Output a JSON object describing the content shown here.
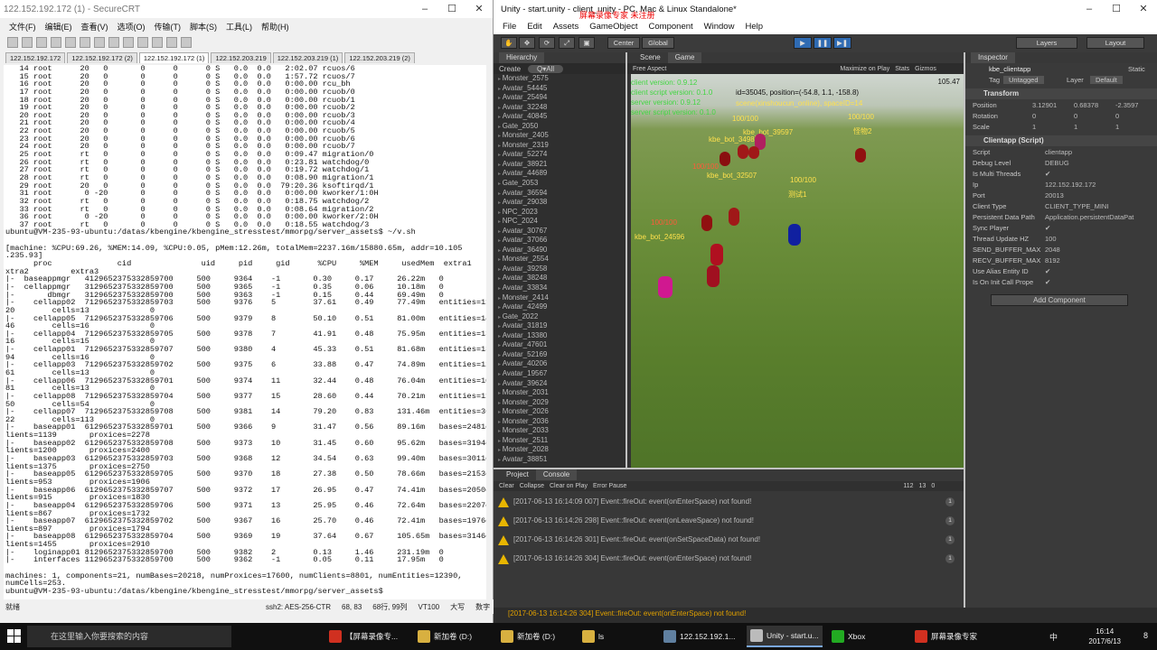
{
  "crt": {
    "title": "122.152.192.172 (1) - SecureCRT",
    "menu": [
      "文件(F)",
      "编辑(E)",
      "查看(V)",
      "选项(O)",
      "传输(T)",
      "脚本(S)",
      "工具(L)",
      "帮助(H)"
    ],
    "tabs": [
      "122.152.192.172",
      "122.152.192.172 (2)",
      "122.152.192.172 (1)",
      "122.152.203.219",
      "122.152.203.219 (1)",
      "122.152.203.219 (2)"
    ],
    "active_tab": 2,
    "terminal_lines": [
      "   14 root      20   0       0      0      0 S   0.0  0.0   2:02.07 rcuos/6",
      "   15 root      20   0       0      0      0 S   0.0  0.0   1:57.72 rcuos/7",
      "   16 root      20   0       0      0      0 S   0.0  0.0   0:00.00 rcu_bh",
      "   17 root      20   0       0      0      0 S   0.0  0.0   0:00.00 rcuob/0",
      "   18 root      20   0       0      0      0 S   0.0  0.0   0:00.00 rcuob/1",
      "   19 root      20   0       0      0      0 S   0.0  0.0   0:00.00 rcuob/2",
      "   20 root      20   0       0      0      0 S   0.0  0.0   0:00.00 rcuob/3",
      "   21 root      20   0       0      0      0 S   0.0  0.0   0:00.00 rcuob/4",
      "   22 root      20   0       0      0      0 S   0.0  0.0   0:00.00 rcuob/5",
      "   23 root      20   0       0      0      0 S   0.0  0.0   0:00.00 rcuob/6",
      "   24 root      20   0       0      0      0 S   0.0  0.0   0:00.00 rcuob/7",
      "   25 root      rt   0       0      0      0 S   0.0  0.0   0:09.47 migration/0",
      "   26 root      rt   0       0      0      0 S   0.0  0.0   0:23.81 watchdog/0",
      "   27 root      rt   0       0      0      0 S   0.0  0.0   0:19.72 watchdog/1",
      "   28 root      rt   0       0      0      0 S   0.0  0.0   0:08.90 migration/1",
      "   29 root      20   0       0      0      0 S   0.0  0.0  79:20.36 ksoftirqd/1",
      "   31 root       0 -20       0      0      0 S   0.0  0.0   0:00.00 kworker/1:0H",
      "   32 root      rt   0       0      0      0 S   0.0  0.0   0:18.75 watchdog/2",
      "   33 root      rt   0       0      0      0 S   0.0  0.0   0:08.64 migration/2",
      "   36 root       0 -20       0      0      0 S   0.0  0.0   0:00.00 kworker/2:0H",
      "   37 root      rt   0       0      0      0 S   0.0  0.0   0:18.55 watchdog/3",
      "ubuntu@VM-235-93-ubuntu:/datas/kbengine/kbengine_stresstest/mmorpg/server_assets$ ~/v.sh",
      "",
      "[machine: %CPU:69.26, %MEM:14.09, %CPU:0.05, pMem:12.26m, totalMem=2237.16m/15880.65m, addr=10.105",
      ".235.93]",
      "      proc              cid               uid     pid     gid      %CPU     %MEM     usedMem  extra1     e",
      "xtra2         extra3",
      "|-  baseappmgr   412965237533285970​0     500     9364    -1       0.30     0.17     26.22m   0          0",
      "|-  cellappmgr   312965237533285970​0     500     9365    -1       0.35     0.06     10.18m   0          0",
      "|-       dbmgr   312965237533285970​0     500     9363    -1       0.15     0.44     69.49m   0          0",
      "|-    cellapp02  712965237533285970​3     500     9376    5        37.61    0.49     77.49m   entities=11",
      "20        cells=13             0",
      "|-    cellapp05  712965237533285970​6     500     9379    8        50.10    0.51     81.00m   entities=14",
      "46        cells=16             0",
      "|-    cellapp04  712965237533285970​5     500     9378    7        41.91    0.48     75.95m   entities=13",
      "16        cells=15             0",
      "|-    cellapp01  712965237533285970​7     500     9380    4        45.33    0.51     81.68m   entities=13",
      "94        cells=16             0",
      "|-    cellapp03  712965237533285970​2     500     9375    6        33.88    0.47     74.89m   entities=12",
      "61        cells=13             0",
      "|-    cellapp06  712965237533285970​1     500     9374    11       32.44    0.48     76.04m   entities=10",
      "81        cells=13             0",
      "|-    cellapp08  712965237533285970​4     500     9377    15       28.60    0.44     70.21m   entities=11",
      "50        cells=54             0",
      "|-    cellapp07  712965237533285970​8     500     9381    14       79.20    0.83     131.46m  entities=36",
      "22        cells=113            0",
      "|-    baseapp01  612965237533285970​1     500     9366    9        31.47    0.56     89.16m   bases=2481c",
      "lients=1139       proxices=2278",
      "|-    baseapp02  612965237533285970​8     500     9373    10       31.45    0.60     95.62m   bases=3194c",
      "lients=1200       proxices=2400",
      "|-    baseapp03  612965237533285970​3     500     9368    12       34.54    0.63     99.40m   bases=3011c",
      "lients=1375       proxices=2750",
      "|-    baseapp05  612965237533285970​5     500     9370    18       27.38    0.50     78.66m   bases=2153c",
      "lients=953        proxices=1906",
      "|-    baseapp06  612965237533285970​7     500     9372    17       26.95    0.47     74.41m   bases=2050c",
      "lients=915        proxices=1830",
      "|-    baseapp04  612965237533285970​6     500     9371    13       25.95    0.46     72.64m   bases=2207c",
      "lients=867        proxices=1732",
      "|-    baseapp07  612965237533285970​2     500     9367    16       25.70    0.46     72.41m   bases=1976c",
      "lients=897        proxices=1794",
      "|-    baseapp08  612965237533285970​4     500     9369    19       37.64    0.67     105.65m  bases=3146c",
      "lients=1455       proxices=2910",
      "|-    loginapp01 812965237533285970​0     500     9382    2        0.13     1.46     231.19m  0          0",
      "|-    interfaces 112965237533285970​0     500     9362    -1       0.05     0.11     17.95m   0          0",
      "",
      "machines: 1, components=21, numBases=20218, numProxices=17600, numClients=8801, numEntities=12390,",
      "numCells=253.",
      "ubuntu@VM-235-93-ubuntu:/datas/kbengine/kbengine_stresstest/mmorpg/server_assets$"
    ],
    "status": {
      "ready": "就绪",
      "ssh": "ssh2: AES-256-CTR",
      "pos": "68, 83",
      "size": "68行, 99列",
      "term": "VT100",
      "caps": "大写",
      "num": "数字"
    }
  },
  "unity": {
    "title": "Unity - start.unity - client_unity - PC, Mac & Linux Standalone*",
    "overlay": "屏幕录像专家  未注册",
    "menu": [
      "File",
      "Edit",
      "Assets",
      "GameObject",
      "Component",
      "Window",
      "Help"
    ],
    "toolbar": {
      "center": "Center",
      "global": "Global",
      "layers": "Layers",
      "layout": "Layout"
    },
    "hierarchy": {
      "tab": "Hierarchy",
      "create": "Create",
      "search_placeholder": "Q▾All",
      "items": [
        "Monster_2575",
        "Avatar_54445",
        "Avatar_25494",
        "Avatar_32248",
        "Avatar_40845",
        "Gate_2050",
        "Monster_2405",
        "Monster_2319",
        "Avatar_52274",
        "Avatar_38921",
        "Avatar_44689",
        "Gate_2053",
        "Avatar_36594",
        "Avatar_29038",
        "NPC_2023",
        "NPC_2024",
        "Avatar_30767",
        "Avatar_37066",
        "Avatar_36490",
        "Monster_2554",
        "Avatar_39258",
        "Avatar_38248",
        "Avatar_33834",
        "Monster_2414",
        "Avatar_42499",
        "Gate_2022",
        "Avatar_31819",
        "Avatar_13380",
        "Avatar_47601",
        "Avatar_52169",
        "Avatar_40206",
        "Avatar_19567",
        "Avatar_39624",
        "Monster_2031",
        "Monster_2029",
        "Monster_2026",
        "Monster_2036",
        "Monster_2033",
        "Monster_2511",
        "Monster_2028",
        "Avatar_38851"
      ]
    },
    "game": {
      "scene_tab": "Scene",
      "game_tab": "Game",
      "aspect": "Free Aspect",
      "maximize": "Maximize on Play",
      "stats": "Stats",
      "gizmos": "Gizmos",
      "fps": "105.47",
      "client_version": "client version: 0.9.12",
      "client_script_version": "client script version: 0.1.0",
      "server_version": "server version: 0.9.12",
      "server_script_version": "server script version: 0.1.0",
      "player_info": "id=35045, position=(-54.8, 1.1, -158.8)",
      "scene_label": "scene(xinshoucun_online), spaceID=14",
      "labels": [
        "100/100",
        "kbe_bot_34983",
        "kbe_bot_39597",
        "100/100",
        "kbe_bot_32507",
        "100/100",
        "测试1",
        "kbe_bot_24596",
        "怪物2",
        "100/100",
        "100/100"
      ]
    },
    "inspector": {
      "tab": "Inspector",
      "object_name": "kbe_clientapp",
      "static": "Static",
      "tag_label": "Tag",
      "tag": "Untagged",
      "layer_label": "Layer",
      "layer": "Default",
      "transform": "Transform",
      "position": {
        "label": "Position",
        "x": "3.12901",
        "y": "0.68378",
        "z": "-2.3597"
      },
      "rotation": {
        "label": "Rotation",
        "x": "0",
        "y": "0",
        "z": "0"
      },
      "scale": {
        "label": "Scale",
        "x": "1",
        "y": "1",
        "z": "1"
      },
      "component": "Clientapp (Script)",
      "fields": [
        {
          "k": "Script",
          "v": "clientapp"
        },
        {
          "k": "Debug Level",
          "v": "DEBUG"
        },
        {
          "k": "Is Multi Threads",
          "v": "✔"
        },
        {
          "k": "Ip",
          "v": "122.152.192.172"
        },
        {
          "k": "Port",
          "v": "20013"
        },
        {
          "k": "Client Type",
          "v": "CLIENT_TYPE_MINI"
        },
        {
          "k": "Persistent Data Path",
          "v": "Application.persistentDataPat"
        },
        {
          "k": "Sync Player",
          "v": "✔"
        },
        {
          "k": "Thread Update HZ",
          "v": "100"
        },
        {
          "k": "SEND_BUFFER_MAX",
          "v": "2048"
        },
        {
          "k": "RECV_BUFFER_MAX",
          "v": "8192"
        },
        {
          "k": "Use Alias Entity ID",
          "v": "✔"
        },
        {
          "k": "Is On Init Call Prope",
          "v": "✔"
        }
      ],
      "add_component": "Add Component"
    },
    "console": {
      "project_tab": "Project",
      "console_tab": "Console",
      "buttons": [
        "Clear",
        "Collapse",
        "Clear on Play",
        "Error Pause"
      ],
      "counts": {
        "info": "112",
        "warn": "13",
        "error": "0"
      },
      "entries": [
        "[2017-06-13 16:14:09 007] Event::fireOut: event(onEnterSpace) not found!",
        "[2017-06-13 16:14:26 298] Event::fireOut: event(onLeaveSpace) not found!",
        "[2017-06-13 16:14:26 301] Event::fireOut: event(onSetSpaceData) not found!",
        "[2017-06-13 16:14:26 304] Event::fireOut: event(onEnterSpace) not found!"
      ],
      "entry_count": "1",
      "status": "[2017-06-13 16:14:26 304] Event::fireOut: event(onEnterSpace) not found!"
    }
  },
  "taskbar": {
    "search_placeholder": "在这里输入你要搜索的内容",
    "apps": [
      "【屏幕录像专...",
      "新加卷 (D:)",
      "新加卷 (D:)",
      "ls",
      "122.152.192.1...",
      "Unity - start.u...",
      "Xbox",
      "屏幕录像专家"
    ],
    "time": "16:14",
    "date": "2017/6/13",
    "ime": "中",
    "notify": "8"
  },
  "colors": {
    "accent": "#2f6bb3",
    "warn": "#e8b600",
    "game_text": "#ffe14d",
    "version_text": "#42d642"
  }
}
